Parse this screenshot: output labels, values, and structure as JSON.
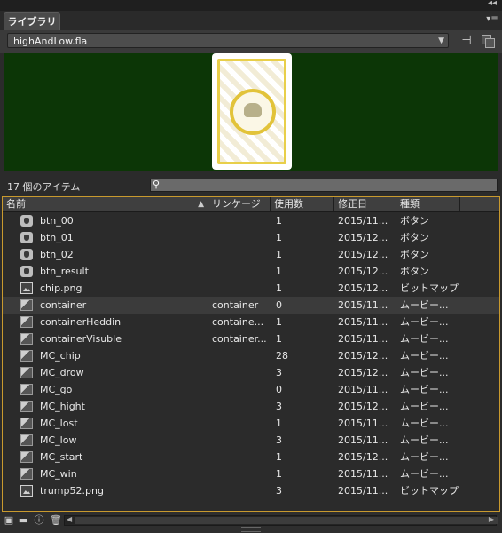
{
  "panel": {
    "tab_label": "ライブラリ",
    "collapse_glyph": "◂◂",
    "menu_glyph": "▾≡"
  },
  "document": {
    "selected": "highAndLow.fla"
  },
  "status": {
    "item_count": "17 個のアイテム",
    "search_placeholder": ""
  },
  "columns": [
    {
      "label": "名前"
    },
    {
      "label": "リンケージ"
    },
    {
      "label": "使用数"
    },
    {
      "label": "修正日"
    },
    {
      "label": "種類"
    }
  ],
  "items": [
    {
      "name": "btn_00",
      "icon": "button-icon",
      "icon_class": "button",
      "linkage": "",
      "uses": "1",
      "modified": "2015/11...",
      "type": "ボタン"
    },
    {
      "name": "btn_01",
      "icon": "button-icon",
      "icon_class": "button",
      "linkage": "",
      "uses": "1",
      "modified": "2015/12...",
      "type": "ボタン"
    },
    {
      "name": "btn_02",
      "icon": "button-icon",
      "icon_class": "button",
      "linkage": "",
      "uses": "1",
      "modified": "2015/12...",
      "type": "ボタン"
    },
    {
      "name": "btn_result",
      "icon": "button-icon",
      "icon_class": "button",
      "linkage": "",
      "uses": "1",
      "modified": "2015/12...",
      "type": "ボタン"
    },
    {
      "name": "chip.png",
      "icon": "bitmap-icon",
      "icon_class": "bitmap",
      "linkage": "",
      "uses": "1",
      "modified": "2015/12...",
      "type": "ビットマップ"
    },
    {
      "name": "container",
      "icon": "movieclip-icon",
      "icon_class": "movieclip",
      "linkage": "container",
      "uses": "0",
      "modified": "2015/11...",
      "type": "ムービー...",
      "selected": true
    },
    {
      "name": "containerHeddin",
      "icon": "movieclip-icon",
      "icon_class": "movieclip",
      "linkage": "containe...",
      "uses": "1",
      "modified": "2015/11...",
      "type": "ムービー..."
    },
    {
      "name": "containerVisuble",
      "icon": "movieclip-icon",
      "icon_class": "movieclip",
      "linkage": "container...",
      "uses": "1",
      "modified": "2015/11...",
      "type": "ムービー..."
    },
    {
      "name": "MC_chip",
      "icon": "movieclip-icon",
      "icon_class": "movieclip",
      "linkage": "",
      "uses": "28",
      "modified": "2015/12...",
      "type": "ムービー..."
    },
    {
      "name": "MC_drow",
      "icon": "movieclip-icon",
      "icon_class": "movieclip",
      "linkage": "",
      "uses": "3",
      "modified": "2015/12...",
      "type": "ムービー..."
    },
    {
      "name": "MC_go",
      "icon": "movieclip-icon",
      "icon_class": "movieclip",
      "linkage": "",
      "uses": "0",
      "modified": "2015/11...",
      "type": "ムービー..."
    },
    {
      "name": "MC_hight",
      "icon": "movieclip-icon",
      "icon_class": "movieclip",
      "linkage": "",
      "uses": "3",
      "modified": "2015/12...",
      "type": "ムービー..."
    },
    {
      "name": "MC_lost",
      "icon": "movieclip-icon",
      "icon_class": "movieclip",
      "linkage": "",
      "uses": "1",
      "modified": "2015/11...",
      "type": "ムービー..."
    },
    {
      "name": "MC_low",
      "icon": "movieclip-icon",
      "icon_class": "movieclip",
      "linkage": "",
      "uses": "3",
      "modified": "2015/11...",
      "type": "ムービー..."
    },
    {
      "name": "MC_start",
      "icon": "movieclip-icon",
      "icon_class": "movieclip",
      "linkage": "",
      "uses": "1",
      "modified": "2015/12...",
      "type": "ムービー..."
    },
    {
      "name": "MC_win",
      "icon": "movieclip-icon",
      "icon_class": "movieclip",
      "linkage": "",
      "uses": "1",
      "modified": "2015/11...",
      "type": "ムービー..."
    },
    {
      "name": "trump52.png",
      "icon": "bitmap-icon",
      "icon_class": "bitmap",
      "linkage": "",
      "uses": "3",
      "modified": "2015/11...",
      "type": "ビットマップ"
    }
  ],
  "colors": {
    "preview_bg": "#0c3606",
    "selection_border": "#c99a2e"
  }
}
